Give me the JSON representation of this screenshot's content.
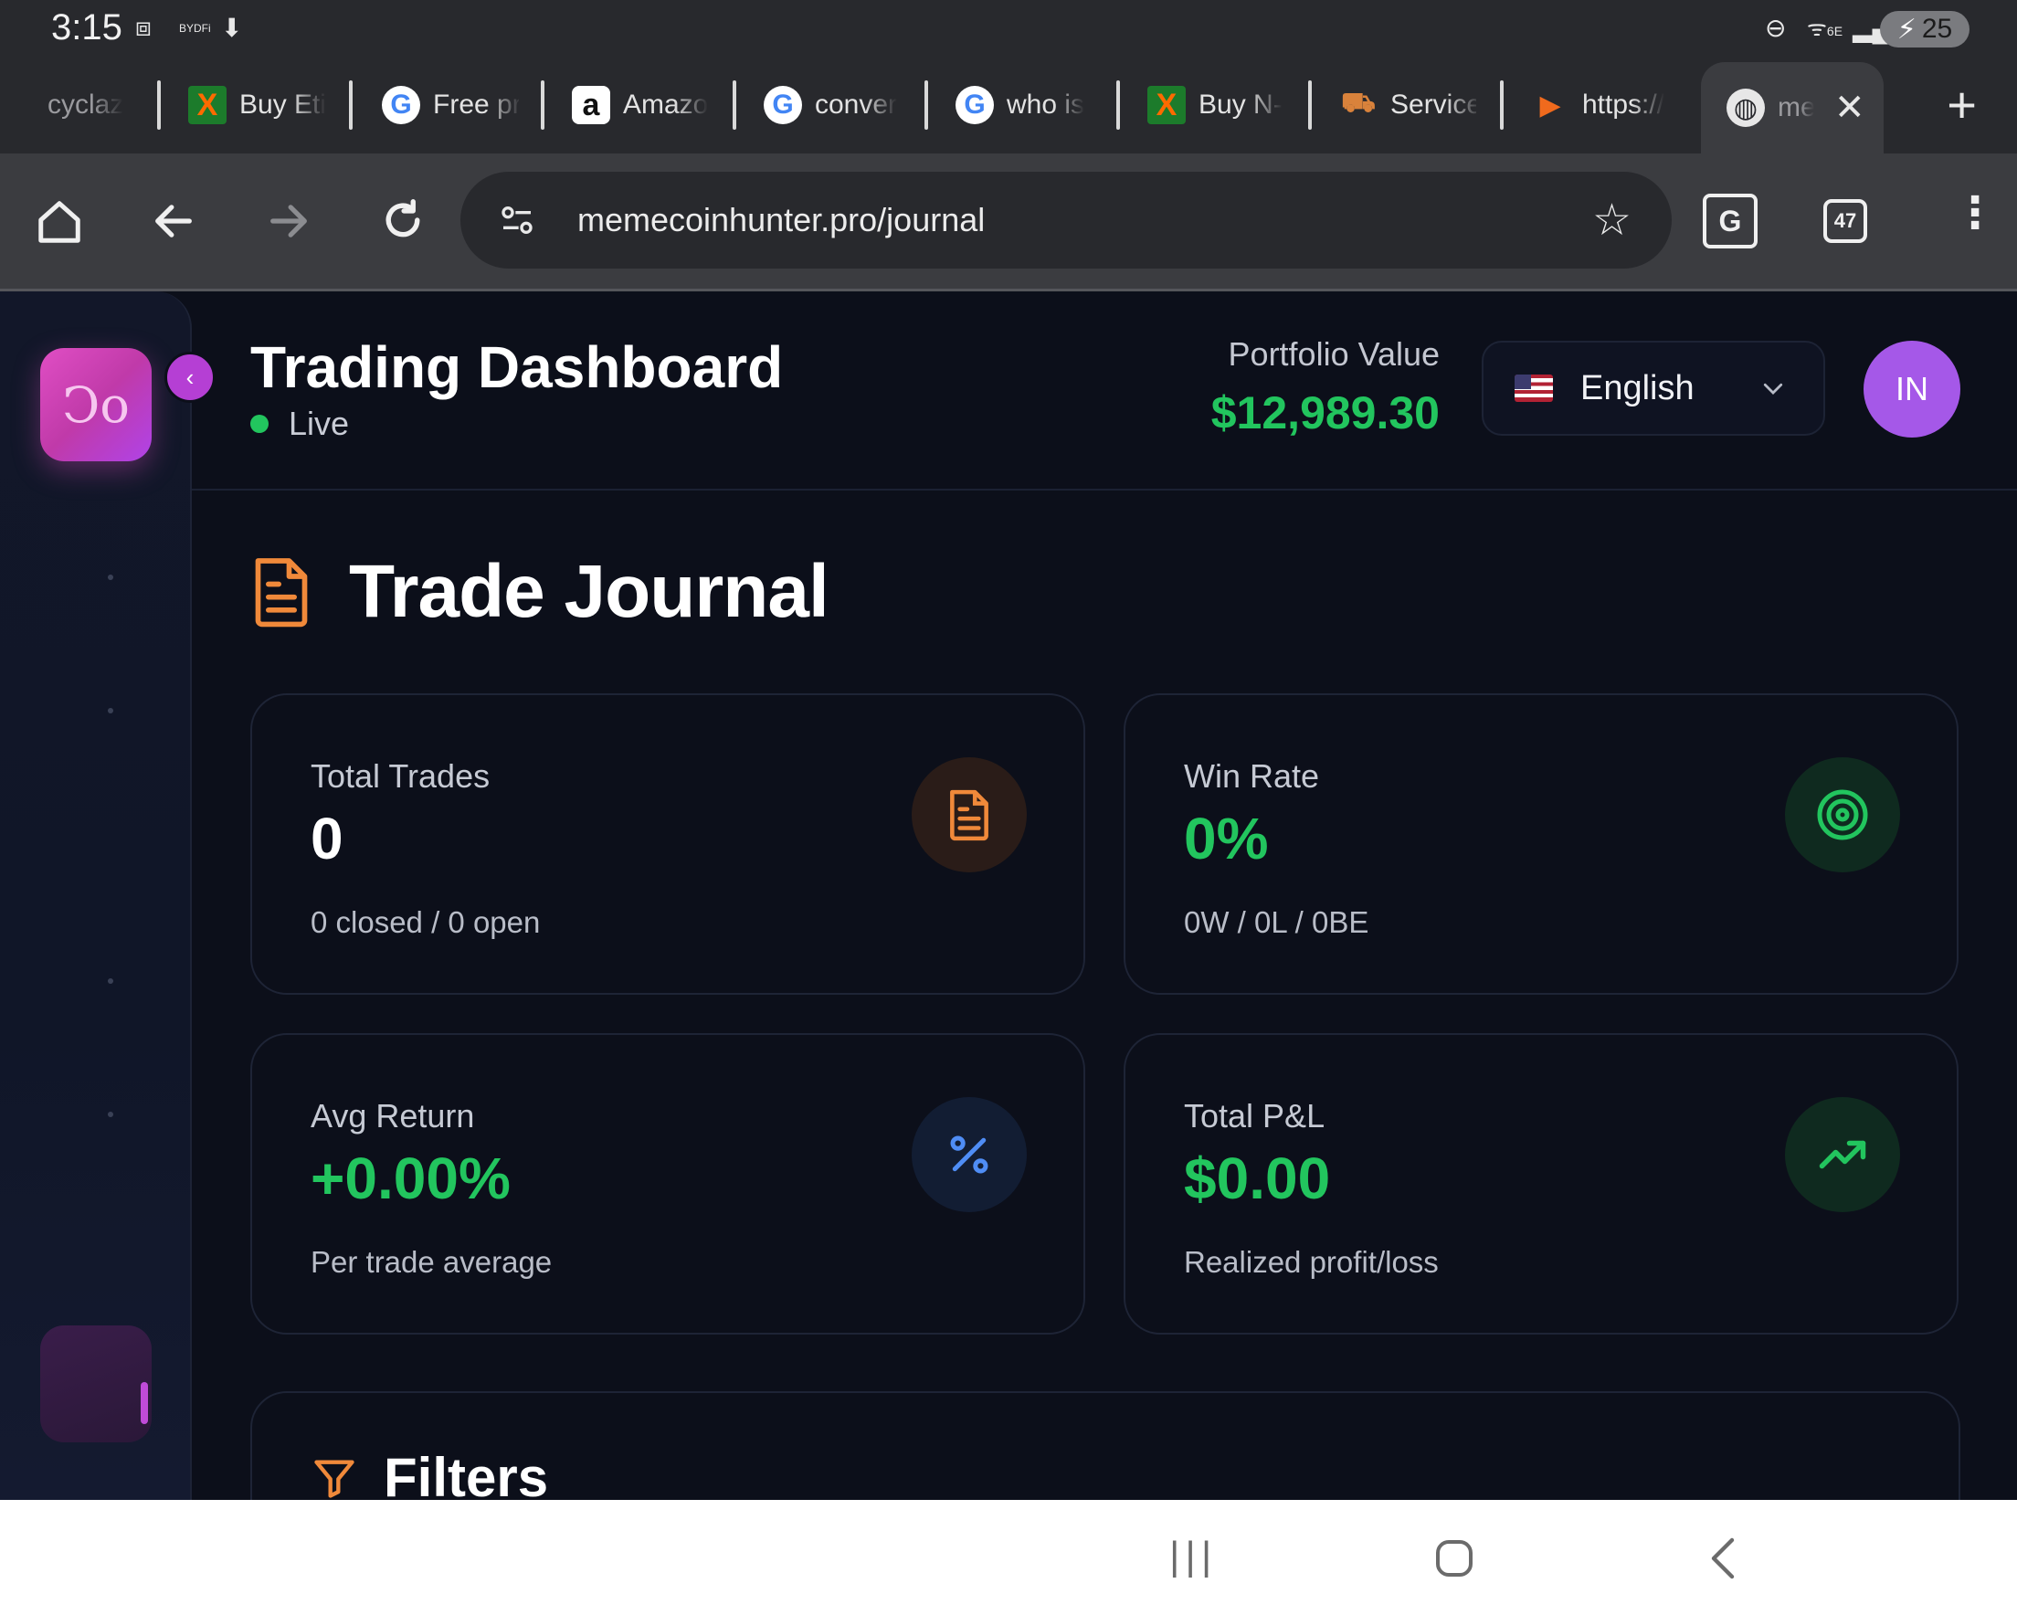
{
  "status_bar": {
    "time": "3:15",
    "battery": "25",
    "network": "6E"
  },
  "tabs": [
    {
      "title": "cyclaz",
      "favicon": "none"
    },
    {
      "title": "Buy Eti",
      "favicon": "x-icon"
    },
    {
      "title": "Free pr",
      "favicon": "google-icon"
    },
    {
      "title": "Amazo",
      "favicon": "amazon-icon"
    },
    {
      "title": "conver",
      "favicon": "google-icon"
    },
    {
      "title": "who is",
      "favicon": "google-icon"
    },
    {
      "title": "Buy N-",
      "favicon": "x-icon"
    },
    {
      "title": "Service",
      "favicon": "truck-icon"
    },
    {
      "title": "https://",
      "favicon": "orange-icon"
    },
    {
      "title": "me",
      "favicon": "globe-icon",
      "active": true
    }
  ],
  "toolbar": {
    "url": "memecoinhunter.pro/journal",
    "tab_count": "47"
  },
  "header": {
    "title": "Trading Dashboard",
    "status": "Live",
    "portfolio_label": "Portfolio Value",
    "portfolio_value": "$12,989.30",
    "language": "English",
    "avatar_initials": "IN"
  },
  "journal": {
    "title": "Trade Journal",
    "cards": [
      {
        "label": "Total Trades",
        "value": "0",
        "sub": "0 closed / 0 open",
        "icon": "document-icon",
        "value_color": "#ffffff",
        "icon_bg": "#2a1c18",
        "icon_color": "#f0893a"
      },
      {
        "label": "Win Rate",
        "value": "0%",
        "sub": "0W / 0L / 0BE",
        "icon": "target-icon",
        "value_color": "#22c55e",
        "icon_bg": "#0f2a1f",
        "icon_color": "#22c55e"
      },
      {
        "label": "Avg Return",
        "value": "+0.00%",
        "sub": "Per trade average",
        "icon": "percent-icon",
        "value_color": "#22c55e",
        "icon_bg": "#121d33",
        "icon_color": "#4f8df5"
      },
      {
        "label": "Total P&L",
        "value": "$0.00",
        "sub": "Realized profit/loss",
        "icon": "trending-up-icon",
        "value_color": "#22c55e",
        "icon_bg": "#0f2a1f",
        "icon_color": "#22c55e"
      }
    ],
    "filters_title": "Filters"
  },
  "colors": {
    "accent_green": "#22c55e",
    "accent_orange": "#f0893a",
    "brand_pink": "#e04ec4",
    "background": "#0c0f1a"
  }
}
